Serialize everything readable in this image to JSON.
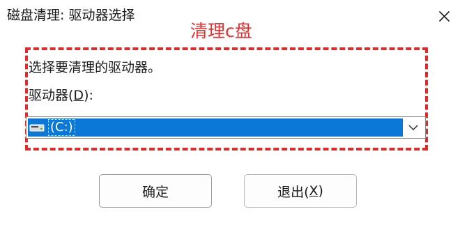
{
  "window": {
    "title": "磁盘清理: 驱动器选择"
  },
  "annotation": {
    "text": "清理c盘",
    "color": "#e02b2b"
  },
  "prompt": {
    "text": "选择要清理的驱动器。"
  },
  "drive_label": {
    "prefix": "驱动器(",
    "accesskey": "D",
    "suffix": "):"
  },
  "drive_select": {
    "selected": "(C:)",
    "icon": "drive-icon",
    "highlight_color": "#0b78d7"
  },
  "buttons": {
    "ok_label": "确定",
    "cancel_prefix": "退出(",
    "cancel_accesskey": "X",
    "cancel_suffix": ")"
  }
}
